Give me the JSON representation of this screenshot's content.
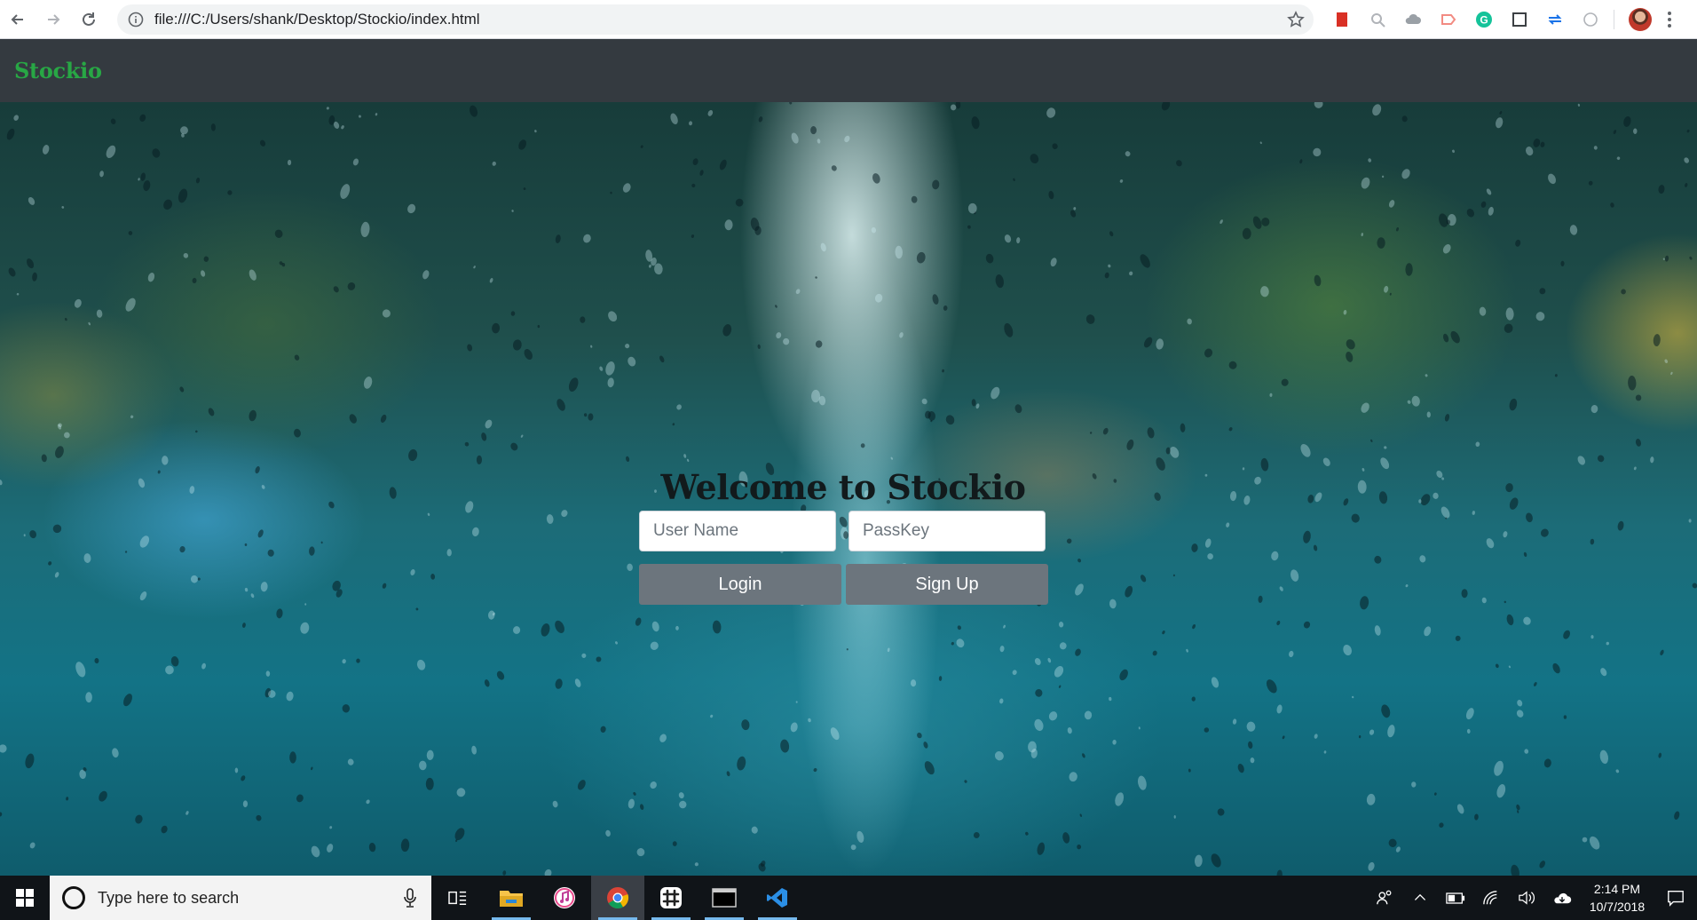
{
  "browser": {
    "url": "file:///C:/Users/shank/Desktop/Stockio/index.html"
  },
  "navbar": {
    "brand": "Stockio",
    "brand_color": "#28a745"
  },
  "login": {
    "heading": "Welcome to Stockio",
    "username_placeholder": "User Name",
    "password_placeholder": "PassKey",
    "login_label": "Login",
    "signup_label": "Sign Up"
  },
  "taskbar": {
    "search_placeholder": "Type here to search",
    "time": "2:14 PM",
    "date": "10/7/2018",
    "apps": [
      "task-view",
      "file-explorer",
      "itunes",
      "chrome",
      "slack",
      "terminal",
      "vscode"
    ]
  },
  "colors": {
    "navbar_bg": "#343a40",
    "button_bg": "#6c757d",
    "hero_tone": "#137386"
  }
}
